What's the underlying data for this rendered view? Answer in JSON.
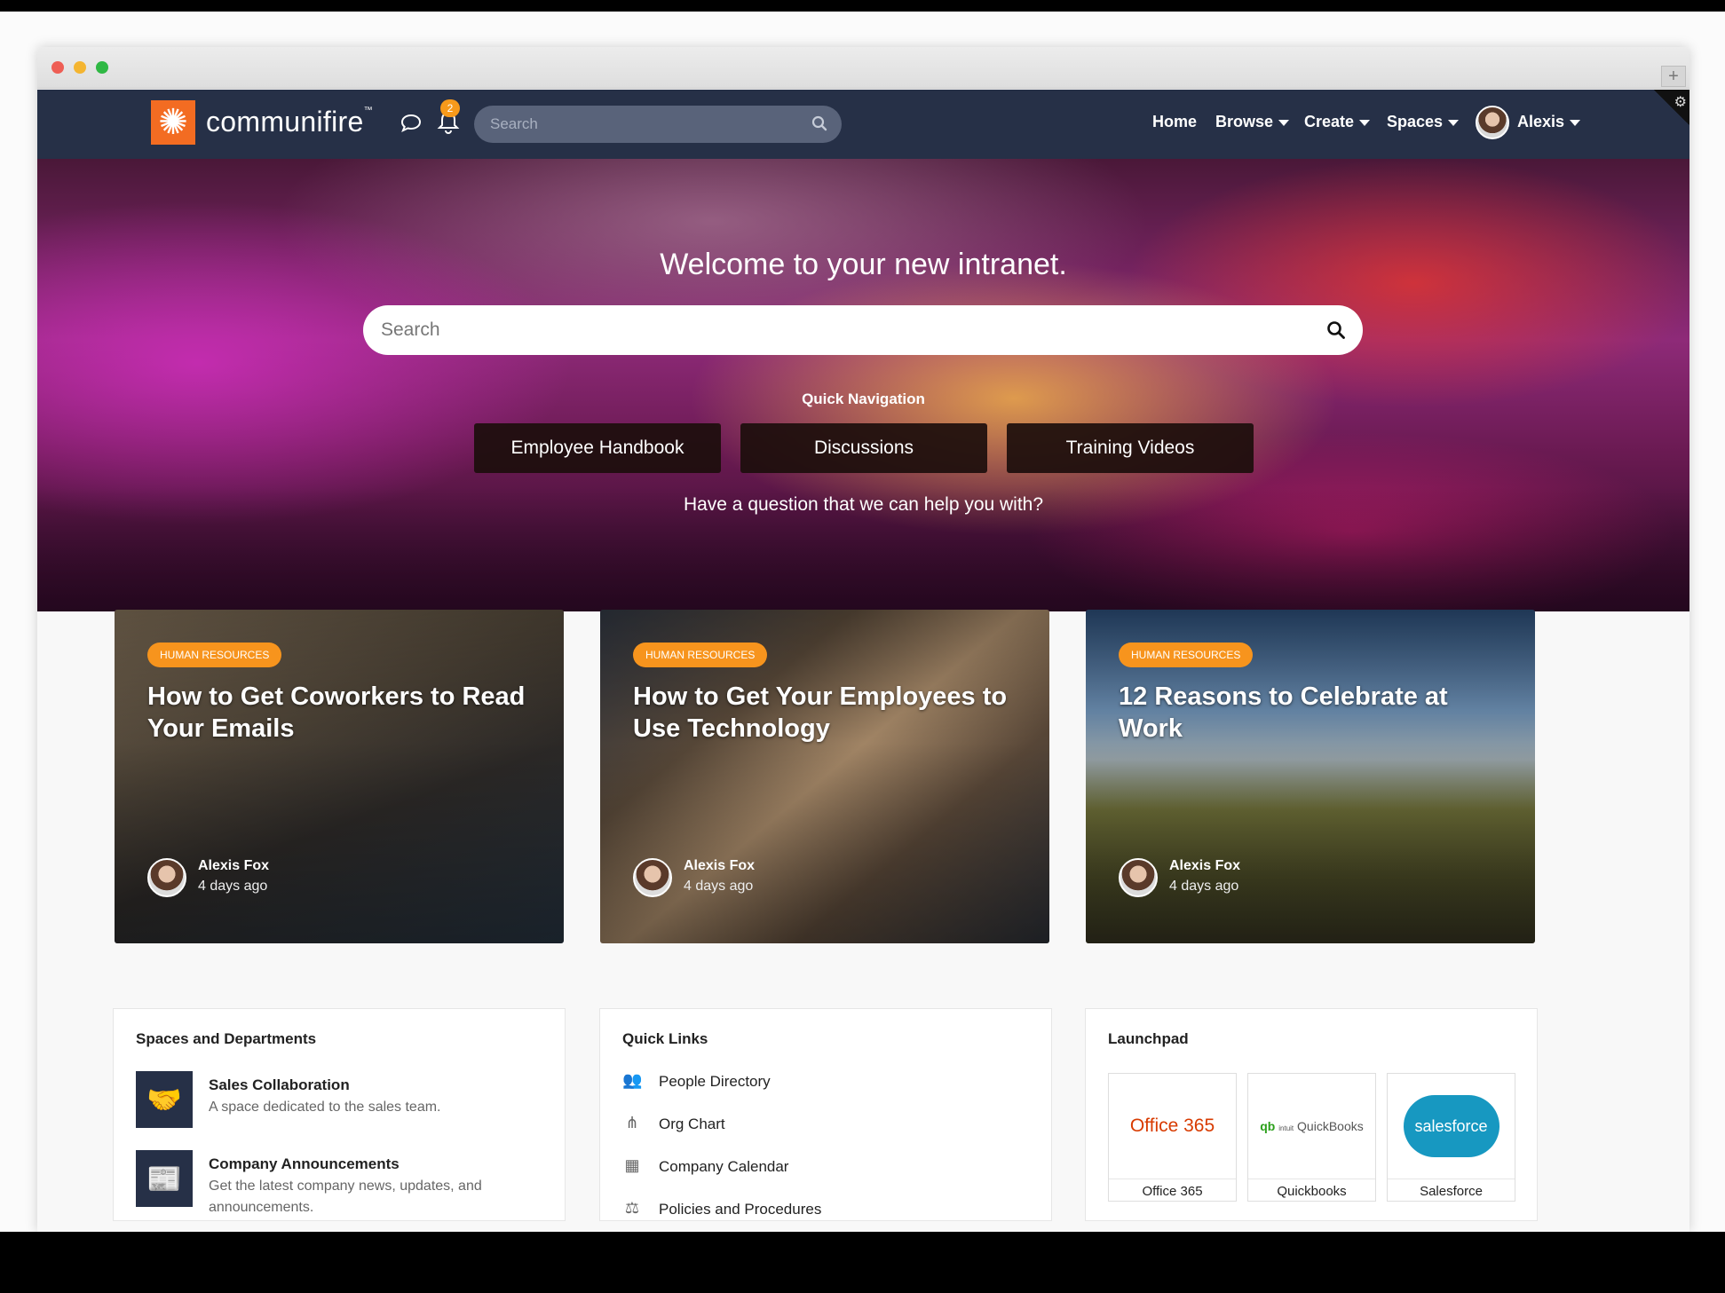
{
  "brand": {
    "logo_text": "communifire",
    "trademark": "™"
  },
  "navbar": {
    "notification_count": "2",
    "search_placeholder": "Search",
    "links": {
      "home": "Home",
      "browse": "Browse",
      "create": "Create",
      "spaces": "Spaces",
      "user": "Alexis"
    }
  },
  "hero": {
    "title": "Welcome to your new intranet.",
    "search_placeholder": "Search",
    "quick_nav_label": "Quick Navigation",
    "buttons": [
      "Employee Handbook",
      "Discussions",
      "Training Videos"
    ],
    "question": "Have a question that we can help you with?"
  },
  "articles": [
    {
      "category": "HUMAN RESOURCES",
      "title": "How to Get Coworkers to Read Your Emails",
      "author": "Alexis Fox",
      "time": "4 days ago"
    },
    {
      "category": "HUMAN RESOURCES",
      "title": "How to Get Your Employees to Use Technology",
      "author": "Alexis Fox",
      "time": "4 days ago"
    },
    {
      "category": "HUMAN RESOURCES",
      "title": "12 Reasons to Celebrate at Work",
      "author": "Alexis Fox",
      "time": "4 days ago"
    }
  ],
  "spaces": {
    "title": "Spaces and Departments",
    "items": [
      {
        "name": "Sales Collaboration",
        "description": "A space dedicated to the sales team.",
        "icon": "handshake-icon"
      },
      {
        "name": "Company Announcements",
        "description": "Get the latest company news, updates, and announcements.",
        "icon": "newspaper-icon"
      }
    ]
  },
  "quick_links": {
    "title": "Quick Links",
    "items": [
      {
        "label": "People Directory",
        "icon": "people-icon"
      },
      {
        "label": "Org Chart",
        "icon": "org-chart-icon"
      },
      {
        "label": "Company Calendar",
        "icon": "calendar-icon"
      },
      {
        "label": "Policies and Procedures",
        "icon": "scales-icon"
      }
    ]
  },
  "launchpad": {
    "title": "Launchpad",
    "apps": [
      {
        "name": "Office 365",
        "logo_text": "Office 365"
      },
      {
        "name": "Quickbooks",
        "logo_text": "QuickBooks",
        "logo_prefix": "qb",
        "logo_note": "intuit"
      },
      {
        "name": "Salesforce",
        "logo_text": "salesforce"
      }
    ]
  },
  "colors": {
    "navbar": "#263047",
    "accent": "#f36c22",
    "badge": "#f7941d"
  }
}
